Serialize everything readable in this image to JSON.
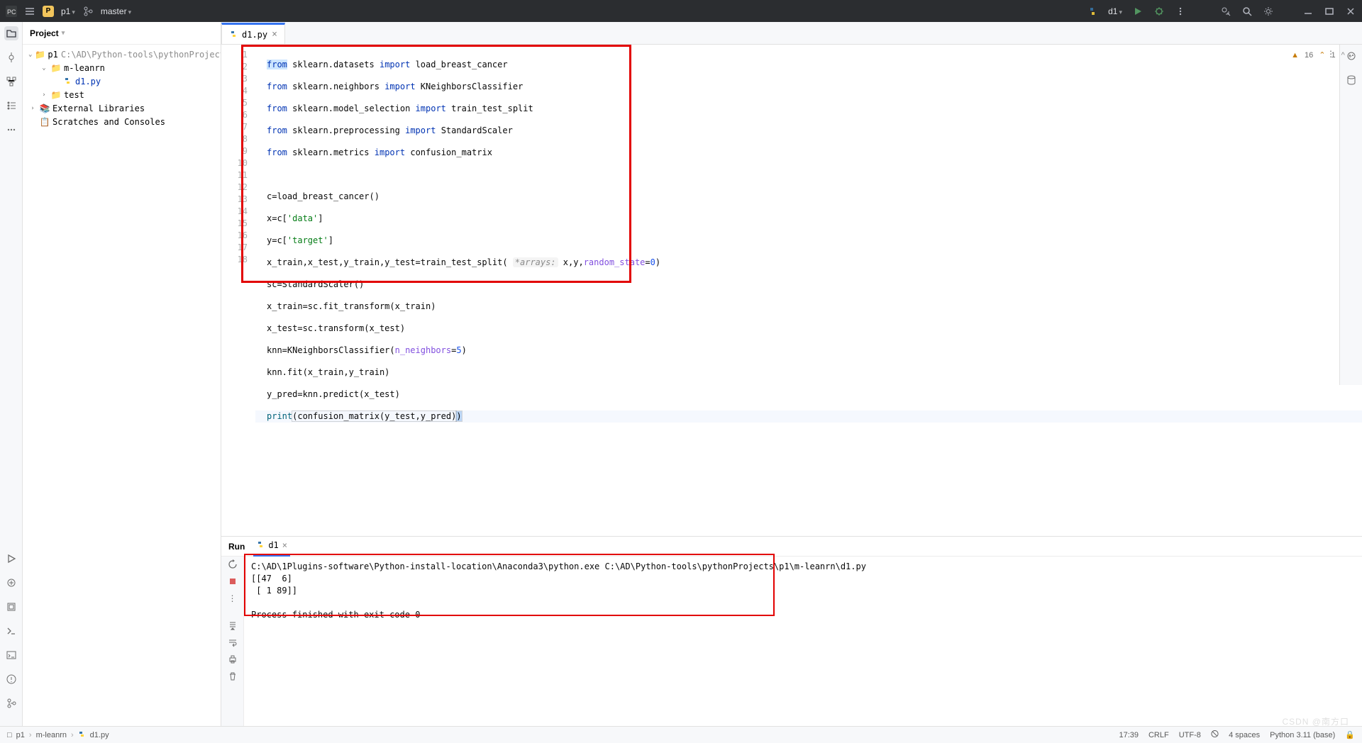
{
  "titlebar": {
    "app_icon": "PC",
    "menu_icon": "menu",
    "project_badge": "P",
    "project_name": "p1",
    "branch_icon": "branch",
    "branch_name": "master",
    "run_config_icon": "python",
    "run_config_name": "d1"
  },
  "project_panel": {
    "title": "Project",
    "tree": [
      {
        "depth": 0,
        "exp": "v",
        "icon": "folder",
        "label": "p1",
        "suffix": "C:\\AD\\Python-tools\\pythonProjects\\p"
      },
      {
        "depth": 1,
        "exp": "v",
        "icon": "folder",
        "label": "m-leanrn"
      },
      {
        "depth": 2,
        "exp": "",
        "icon": "py",
        "label": "d1.py",
        "sel": true
      },
      {
        "depth": 1,
        "exp": ">",
        "icon": "folder",
        "label": "test"
      },
      {
        "depth": 0,
        "exp": ">",
        "icon": "lib",
        "label": "External Libraries"
      },
      {
        "depth": 0,
        "exp": "",
        "icon": "scratch",
        "label": "Scratches and Consoles"
      }
    ]
  },
  "editor": {
    "tab_label": "d1.py",
    "inspection": {
      "warn_icon": "⚠",
      "warn_count": "16",
      "weak_icon": "^",
      "weak_count": "1"
    },
    "lines": [
      "1",
      "2",
      "3",
      "4",
      "5",
      "6",
      "7",
      "8",
      "9",
      "10",
      "11",
      "12",
      "13",
      "14",
      "15",
      "16",
      "17",
      "18"
    ],
    "code": {
      "l1": {
        "from": "from",
        "mod": "sklearn.datasets",
        "imp": "import",
        "name": "load_breast_cancer"
      },
      "l2": {
        "from": "from",
        "mod": "sklearn.neighbors",
        "imp": "import",
        "name": "KNeighborsClassifier"
      },
      "l3": {
        "from": "from",
        "mod": "sklearn.model_selection",
        "imp": "import",
        "name": "train_test_split"
      },
      "l4": {
        "from": "from",
        "mod": "sklearn.preprocessing",
        "imp": "import",
        "name": "StandardScaler"
      },
      "l5": {
        "from": "from",
        "mod": "sklearn.metrics",
        "imp": "import",
        "name": "confusion_matrix"
      },
      "l7": "c=load_breast_cancer()",
      "l8": {
        "pre": "x=c[",
        "s": "'data'",
        "post": "]"
      },
      "l9": {
        "pre": "y=c[",
        "s": "'target'",
        "post": "]"
      },
      "l10": {
        "a": "x_train,x_test,y_train,y_test=train_test_split( ",
        "hint": "*arrays:",
        "b": " x,y,",
        "p": "random_state",
        "eq": "=",
        "n": "0",
        "c": ")"
      },
      "l11": "sc=StandardScaler()",
      "l12": "x_train=sc.fit_transform(x_train)",
      "l13": "x_test=sc.transform(x_test)",
      "l14": {
        "a": "knn=KNeighborsClassifier(",
        "p": "n_neighbors",
        "eq": "=",
        "n": "5",
        "b": ")"
      },
      "l15": "knn.fit(x_train,y_train)",
      "l16": "y_pred=knn.predict(x_test)",
      "l17": {
        "fn": "print",
        "a": "(confusion_matrix(y_test,y_pred)",
        ")": ")"
      }
    }
  },
  "run": {
    "header_label": "Run",
    "tab_name": "d1",
    "output": [
      "C:\\AD\\1Plugins-software\\Python-install-location\\Anaconda3\\python.exe C:\\AD\\Python-tools\\pythonProjects\\p1\\m-leanrn\\d1.py",
      "[[47  6]",
      " [ 1 89]]",
      "",
      "Process finished with exit code 0"
    ]
  },
  "statusbar": {
    "breadcrumb": [
      "p1",
      "m-leanrn",
      "d1.py"
    ],
    "bc_icons": [
      "□",
      "",
      "py"
    ],
    "time": "17:39",
    "line_sep": "CRLF",
    "encoding": "UTF-8",
    "indent": "4 spaces",
    "interpreter": "Python 3.11 (base)",
    "lock": "🔒"
  },
  "watermark": "CSDN @南方口"
}
